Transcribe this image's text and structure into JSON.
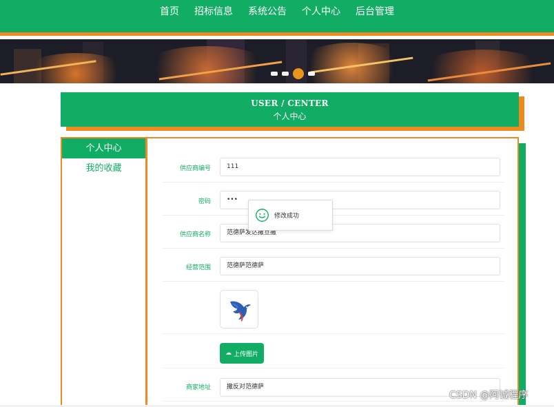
{
  "nav": {
    "items": [
      "首页",
      "招标信息",
      "系统公告",
      "个人中心",
      "后台管理"
    ]
  },
  "section": {
    "title_en": "USER / CENTER",
    "title_cn": "个人中心"
  },
  "sidebar": {
    "items": [
      {
        "label": "个人中心",
        "active": true
      },
      {
        "label": "我的收藏",
        "active": false
      }
    ]
  },
  "form": {
    "supplier_no": {
      "label": "供应商编号",
      "value": "111"
    },
    "password": {
      "label": "密码",
      "value": "•••"
    },
    "supplier_name": {
      "label": "供应商名称",
      "value": "范德萨发达撒旦撒"
    },
    "business_scope": {
      "label": "经营范围",
      "value": "范德萨范德萨"
    },
    "upload_label": "上传图片",
    "address": {
      "label": "商家地址",
      "value": "撒反对范德萨"
    }
  },
  "toast": {
    "message": "修改成功"
  },
  "watermark": "CSDN @阿诚程序",
  "colors": {
    "primary": "#12ad65",
    "accent": "#ee8a1f"
  }
}
